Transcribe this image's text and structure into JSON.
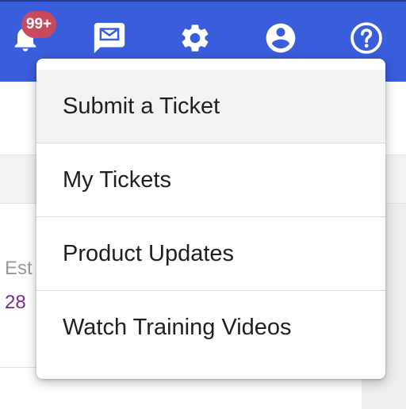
{
  "header": {
    "notifications_badge": "99+",
    "icons": [
      "bell-icon",
      "mail-icon",
      "gear-icon",
      "account-icon",
      "help-icon"
    ]
  },
  "background": {
    "label_partial": "Est",
    "value_partial": "28"
  },
  "help_menu": {
    "items": [
      {
        "label": "Submit a Ticket",
        "highlighted": true
      },
      {
        "label": "My Tickets",
        "highlighted": false
      },
      {
        "label": "Product Updates",
        "highlighted": false
      },
      {
        "label": "Watch Training Videos",
        "highlighted": false
      }
    ]
  },
  "colors": {
    "header_bg": "#3a5ddb",
    "badge_bg": "#c94a5c",
    "value_text": "#7b2a9a"
  }
}
